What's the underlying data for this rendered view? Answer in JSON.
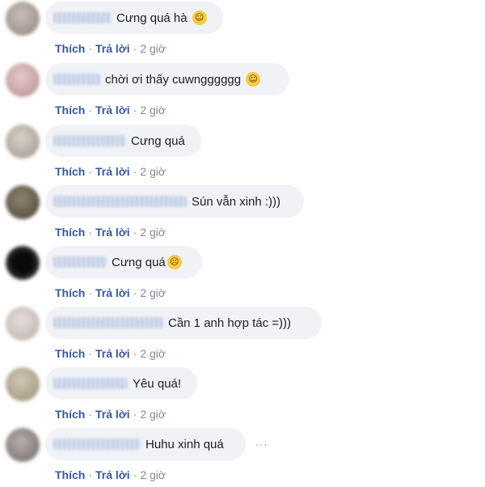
{
  "actions": {
    "like": "Thích",
    "sep": "·",
    "reply": "Trả lời",
    "time": "2 giờ"
  },
  "more_icon": "···",
  "comments": [
    {
      "text": "Cưng quá hà",
      "emoji": "grinning-face-icon",
      "emoji_glyph": "☺"
    },
    {
      "text": "chời ơi thấy cuwngggggg",
      "emoji": "blushing-face-icon",
      "emoji_glyph": "☺"
    },
    {
      "text": "Cưng quá"
    },
    {
      "text": "Sún vẫn xinh :)))"
    },
    {
      "text": "Cưng quá",
      "emoji": "crying-face-icon",
      "emoji_glyph": "☹"
    },
    {
      "text": "Cần 1 anh hợp tác =)))"
    },
    {
      "text": "Yêu quá!"
    },
    {
      "text": "Huhu xinh quá"
    }
  ],
  "colors": {
    "link": "#385898",
    "meta": "#7f8896",
    "bubble": "#f0f2f5",
    "text": "#1c1e21"
  }
}
